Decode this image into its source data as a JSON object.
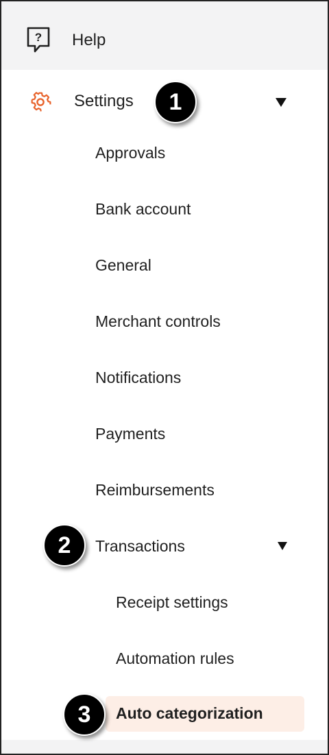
{
  "nav": {
    "help": {
      "label": "Help",
      "icon": "help-chat-icon"
    },
    "settings": {
      "label": "Settings",
      "icon": "gear-icon",
      "icon_color": "#e8622a"
    },
    "settings_items": [
      {
        "label": "Approvals"
      },
      {
        "label": "Bank account"
      },
      {
        "label": "General"
      },
      {
        "label": "Merchant controls"
      },
      {
        "label": "Notifications"
      },
      {
        "label": "Payments"
      },
      {
        "label": "Reimbursements"
      },
      {
        "label": "Transactions"
      }
    ],
    "transactions_items": [
      {
        "label": "Receipt settings"
      },
      {
        "label": "Automation rules"
      },
      {
        "label": "Auto categorization",
        "active": true
      }
    ],
    "active_color": "#fdeee6"
  },
  "annotations": {
    "badge_1": "1",
    "badge_2": "2",
    "badge_3": "3"
  }
}
